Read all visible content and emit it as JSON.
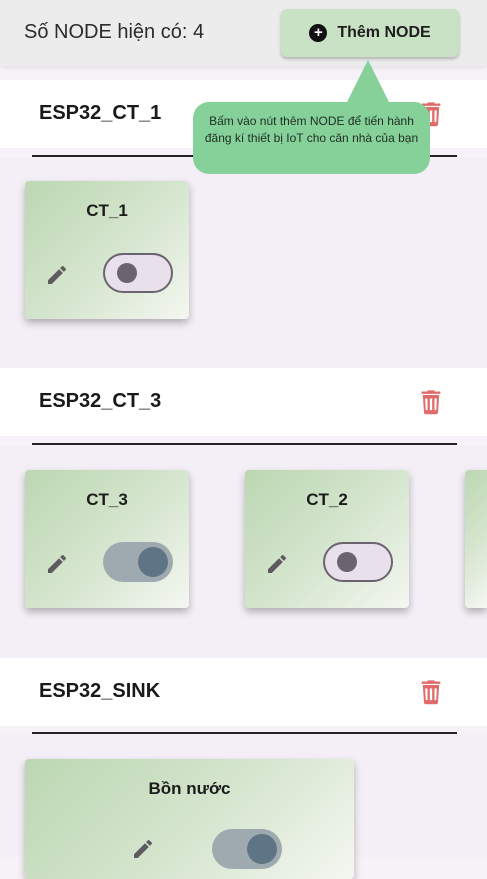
{
  "header": {
    "count_label": "Số NODE hiện có: 4",
    "add_button_label": "Thêm NODE"
  },
  "tooltip": {
    "text": "Bấm vào nút thêm NODE để tiến hành đăng kí thiết bị IoT cho căn nhà của bạn"
  },
  "nodes": [
    {
      "name": "ESP32_CT_1",
      "devices": [
        {
          "label": "CT_1",
          "state": "off"
        }
      ]
    },
    {
      "name": "ESP32_CT_3",
      "devices": [
        {
          "label": "CT_3",
          "state": "on"
        },
        {
          "label": "CT_2",
          "state": "off"
        }
      ]
    },
    {
      "name": "ESP32_SINK",
      "devices": [
        {
          "label": "Bồn nước",
          "state": "on"
        }
      ]
    }
  ],
  "colors": {
    "accent_button": "#c9e2c5",
    "tooltip": "#86d19a",
    "trash": "#e06b6b",
    "card_gradient_start": "#bcd7b2"
  }
}
